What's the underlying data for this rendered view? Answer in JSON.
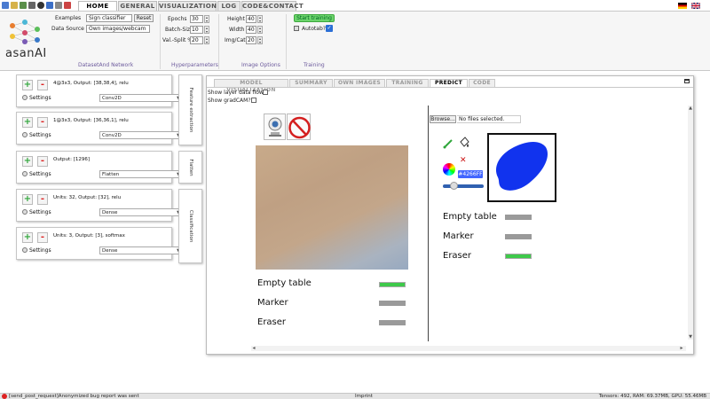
{
  "app": {
    "logo_text": "asanAI"
  },
  "ribbon_tabs": [
    {
      "label": "Home",
      "active": true
    },
    {
      "label": "General",
      "active": false
    },
    {
      "label": "Visualization",
      "active": false
    },
    {
      "label": "Log",
      "active": false
    },
    {
      "label": "Code&Contact",
      "active": false
    }
  ],
  "dataset_group": {
    "examples_label": "Examples",
    "examples_value": "Sign classifier",
    "reset_label": "Reset",
    "data_source_label": "Data Source",
    "data_source_value": "Own images/webcam",
    "title": "DatasetAnd Network"
  },
  "hyper_group": {
    "epochs_label": "Epochs",
    "epochs_value": "30",
    "batch_label": "Batch-Size",
    "batch_value": "10",
    "val_label": "Val.-Split %",
    "val_value": "20",
    "title": "Hyperparameters"
  },
  "image_group": {
    "height_label": "Height",
    "height_value": "40",
    "width_label": "Width",
    "width_value": "40",
    "imgcat_label": "Img/Cat",
    "imgcat_value": "20",
    "title": "Image Options"
  },
  "training_group": {
    "start_label": "Start training",
    "autotab_label": "Autotab?",
    "autotab_checked": true,
    "title": "Training"
  },
  "layers": [
    {
      "desc": "4@3x3, Output: [38,38,4], relu",
      "settings": "Settings",
      "type": "Conv2D"
    },
    {
      "desc": "1@3x3, Output: [36,36,1], relu",
      "settings": "Settings",
      "type": "Conv2D"
    },
    {
      "desc": "Output: [1296]",
      "settings": "Settings",
      "type": "Flatten"
    },
    {
      "desc": "Units: 32, Output: [32], relu",
      "settings": "Settings",
      "type": "Dense"
    },
    {
      "desc": "Units: 3, Output: [3], softmax",
      "settings": "Settings",
      "type": "Dense"
    }
  ],
  "layer_groups": [
    {
      "label": "Feature extraction"
    },
    {
      "label": "Flatten"
    },
    {
      "label": "Classification"
    }
  ],
  "main_tabs": [
    {
      "label": "Model Visualization",
      "active": false
    },
    {
      "label": "Summary",
      "active": false
    },
    {
      "label": "Own images",
      "active": false
    },
    {
      "label": "Training",
      "active": false
    },
    {
      "label": "Predict",
      "active": true
    },
    {
      "label": "Code",
      "active": false
    }
  ],
  "predict": {
    "show_flow_label": "Show layer data flow?",
    "show_gradcam_label": "Show gradCAM?",
    "browse_label": "Browse...",
    "no_file_label": "No files selected.",
    "color_value": "#4266FF",
    "webcam_results": [
      {
        "label": "Empty table",
        "probability": 1.0,
        "winner": true
      },
      {
        "label": "Marker",
        "probability": 0.0,
        "winner": false
      },
      {
        "label": "Eraser",
        "probability": 0.0,
        "winner": false
      }
    ],
    "drawing_results": [
      {
        "label": "Empty table",
        "probability": 0.0,
        "winner": false
      },
      {
        "label": "Marker",
        "probability": 0.0,
        "winner": false
      },
      {
        "label": "Eraser",
        "probability": 1.0,
        "winner": true
      }
    ],
    "brush_color": "#1133ee"
  },
  "statusbar": {
    "left": "[send_post_request]Anonymized bug report was sent",
    "center": "Imprint",
    "right": "Tensors: 492, RAM: 69.37MB, GPU: 55.46MB"
  },
  "colors": {
    "start_button": "#6cd46c",
    "accent_purple": "#6c5a9c",
    "win_bar": "#3ec94a",
    "brush": "#1133ee"
  }
}
